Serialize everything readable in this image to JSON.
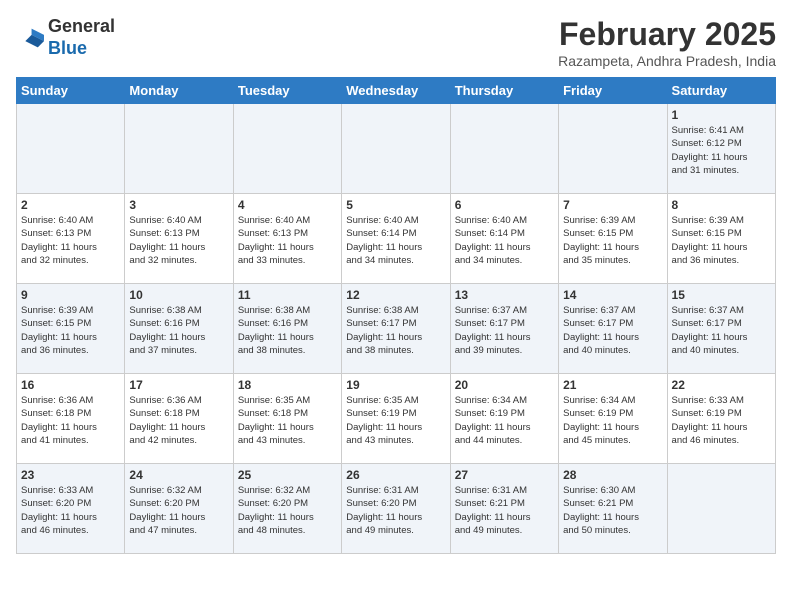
{
  "header": {
    "logo_general": "General",
    "logo_blue": "Blue",
    "month_year": "February 2025",
    "location": "Razampeta, Andhra Pradesh, India"
  },
  "days_of_week": [
    "Sunday",
    "Monday",
    "Tuesday",
    "Wednesday",
    "Thursday",
    "Friday",
    "Saturday"
  ],
  "weeks": [
    [
      {
        "day": "",
        "info": ""
      },
      {
        "day": "",
        "info": ""
      },
      {
        "day": "",
        "info": ""
      },
      {
        "day": "",
        "info": ""
      },
      {
        "day": "",
        "info": ""
      },
      {
        "day": "",
        "info": ""
      },
      {
        "day": "1",
        "info": "Sunrise: 6:41 AM\nSunset: 6:12 PM\nDaylight: 11 hours\nand 31 minutes."
      }
    ],
    [
      {
        "day": "2",
        "info": "Sunrise: 6:40 AM\nSunset: 6:13 PM\nDaylight: 11 hours\nand 32 minutes."
      },
      {
        "day": "3",
        "info": "Sunrise: 6:40 AM\nSunset: 6:13 PM\nDaylight: 11 hours\nand 32 minutes."
      },
      {
        "day": "4",
        "info": "Sunrise: 6:40 AM\nSunset: 6:13 PM\nDaylight: 11 hours\nand 33 minutes."
      },
      {
        "day": "5",
        "info": "Sunrise: 6:40 AM\nSunset: 6:14 PM\nDaylight: 11 hours\nand 34 minutes."
      },
      {
        "day": "6",
        "info": "Sunrise: 6:40 AM\nSunset: 6:14 PM\nDaylight: 11 hours\nand 34 minutes."
      },
      {
        "day": "7",
        "info": "Sunrise: 6:39 AM\nSunset: 6:15 PM\nDaylight: 11 hours\nand 35 minutes."
      },
      {
        "day": "8",
        "info": "Sunrise: 6:39 AM\nSunset: 6:15 PM\nDaylight: 11 hours\nand 36 minutes."
      }
    ],
    [
      {
        "day": "9",
        "info": "Sunrise: 6:39 AM\nSunset: 6:15 PM\nDaylight: 11 hours\nand 36 minutes."
      },
      {
        "day": "10",
        "info": "Sunrise: 6:38 AM\nSunset: 6:16 PM\nDaylight: 11 hours\nand 37 minutes."
      },
      {
        "day": "11",
        "info": "Sunrise: 6:38 AM\nSunset: 6:16 PM\nDaylight: 11 hours\nand 38 minutes."
      },
      {
        "day": "12",
        "info": "Sunrise: 6:38 AM\nSunset: 6:17 PM\nDaylight: 11 hours\nand 38 minutes."
      },
      {
        "day": "13",
        "info": "Sunrise: 6:37 AM\nSunset: 6:17 PM\nDaylight: 11 hours\nand 39 minutes."
      },
      {
        "day": "14",
        "info": "Sunrise: 6:37 AM\nSunset: 6:17 PM\nDaylight: 11 hours\nand 40 minutes."
      },
      {
        "day": "15",
        "info": "Sunrise: 6:37 AM\nSunset: 6:17 PM\nDaylight: 11 hours\nand 40 minutes."
      }
    ],
    [
      {
        "day": "16",
        "info": "Sunrise: 6:36 AM\nSunset: 6:18 PM\nDaylight: 11 hours\nand 41 minutes."
      },
      {
        "day": "17",
        "info": "Sunrise: 6:36 AM\nSunset: 6:18 PM\nDaylight: 11 hours\nand 42 minutes."
      },
      {
        "day": "18",
        "info": "Sunrise: 6:35 AM\nSunset: 6:18 PM\nDaylight: 11 hours\nand 43 minutes."
      },
      {
        "day": "19",
        "info": "Sunrise: 6:35 AM\nSunset: 6:19 PM\nDaylight: 11 hours\nand 43 minutes."
      },
      {
        "day": "20",
        "info": "Sunrise: 6:34 AM\nSunset: 6:19 PM\nDaylight: 11 hours\nand 44 minutes."
      },
      {
        "day": "21",
        "info": "Sunrise: 6:34 AM\nSunset: 6:19 PM\nDaylight: 11 hours\nand 45 minutes."
      },
      {
        "day": "22",
        "info": "Sunrise: 6:33 AM\nSunset: 6:19 PM\nDaylight: 11 hours\nand 46 minutes."
      }
    ],
    [
      {
        "day": "23",
        "info": "Sunrise: 6:33 AM\nSunset: 6:20 PM\nDaylight: 11 hours\nand 46 minutes."
      },
      {
        "day": "24",
        "info": "Sunrise: 6:32 AM\nSunset: 6:20 PM\nDaylight: 11 hours\nand 47 minutes."
      },
      {
        "day": "25",
        "info": "Sunrise: 6:32 AM\nSunset: 6:20 PM\nDaylight: 11 hours\nand 48 minutes."
      },
      {
        "day": "26",
        "info": "Sunrise: 6:31 AM\nSunset: 6:20 PM\nDaylight: 11 hours\nand 49 minutes."
      },
      {
        "day": "27",
        "info": "Sunrise: 6:31 AM\nSunset: 6:21 PM\nDaylight: 11 hours\nand 49 minutes."
      },
      {
        "day": "28",
        "info": "Sunrise: 6:30 AM\nSunset: 6:21 PM\nDaylight: 11 hours\nand 50 minutes."
      },
      {
        "day": "",
        "info": ""
      }
    ]
  ]
}
